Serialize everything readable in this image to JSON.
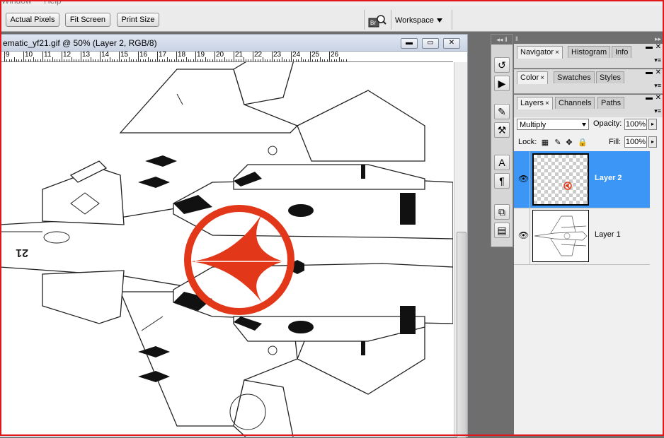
{
  "menu": {
    "window": "Window",
    "help": "Help"
  },
  "options_bar": {
    "actual_pixels": "Actual Pixels",
    "fit_screen": "Fit Screen",
    "print_size": "Print Size",
    "bridge_icon_label": "Br",
    "workspace": "Workspace"
  },
  "document": {
    "title": "ematic_yf21.gif @ 50% (Layer 2, RGB/8)",
    "ruler_numbers": [
      "9",
      "10",
      "11",
      "12",
      "13",
      "14",
      "15",
      "16",
      "17",
      "18",
      "19",
      "20",
      "21",
      "22",
      "23",
      "24",
      "25",
      "26"
    ],
    "artwork_marking": "21"
  },
  "panels": {
    "group1_tabs": [
      {
        "label": "Navigator",
        "close": "×"
      },
      {
        "label": "Histogram"
      },
      {
        "label": "Info"
      }
    ],
    "group2_tabs": [
      {
        "label": "Color",
        "close": "×"
      },
      {
        "label": "Swatches"
      },
      {
        "label": "Styles"
      }
    ],
    "group3_tabs": [
      {
        "label": "Layers",
        "close": "×"
      },
      {
        "label": "Channels"
      },
      {
        "label": "Paths"
      }
    ]
  },
  "layers": {
    "blend_mode": "Multiply",
    "opacity_label": "Opacity:",
    "opacity_value": "100%",
    "lock_label": "Lock:",
    "fill_label": "Fill:",
    "fill_value": "100%",
    "items": [
      {
        "name": "Layer 2",
        "selected": true
      },
      {
        "name": "Layer 1",
        "selected": false
      }
    ]
  },
  "colors": {
    "selection": "#3b96f5",
    "frame_border": "#e0171b",
    "insignia_red": "#e23719"
  }
}
